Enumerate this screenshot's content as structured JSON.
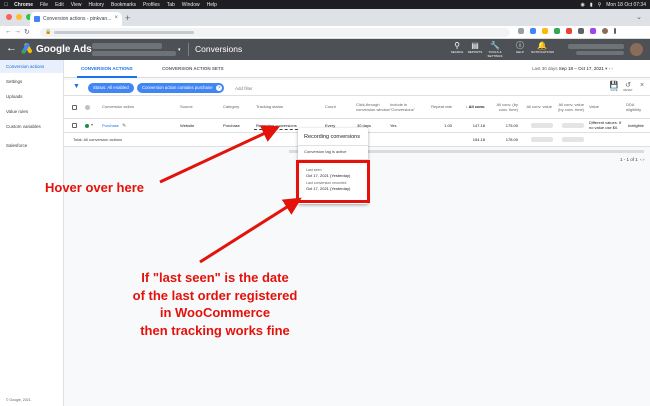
{
  "menubar": {
    "items": [
      "Chrome",
      "File",
      "Edit",
      "View",
      "History",
      "Bookmarks",
      "Profiles",
      "Tab",
      "Window",
      "Help"
    ],
    "clock": "Mon 18 Oct  07:34"
  },
  "browser": {
    "tab_title": "Conversion actions - pinkvan..."
  },
  "ads": {
    "brand": "Google Ads",
    "page_title": "Conversions",
    "header_icons": [
      "SEARCH",
      "REPORTS",
      "TOOLS & SETTINGS",
      "HELP",
      "NOTIFICATIONS"
    ]
  },
  "sidebar": {
    "items": [
      "Conversion actions",
      "Settings",
      "Uploads",
      "Value rules",
      "Custom variables",
      "Salesforce"
    ],
    "copyright": "© Google, 2021."
  },
  "subtabs": {
    "actions": "CONVERSION ACTIONS",
    "sets": "CONVERSION ACTION SETS",
    "range_label": "Last 30 days",
    "range_value": "Sep 18 – Oct 17, 2021"
  },
  "filters": {
    "chip1": "Status: All enabled",
    "chip2": "Conversion action contains purchase",
    "add_filter": "Add filter",
    "icon_labels": [
      "SAVE",
      "RESET"
    ]
  },
  "table": {
    "headers": {
      "action": "Conversion action",
      "source": "Source",
      "category": "Category",
      "tracking": "Tracking status",
      "count": "Count",
      "window": "Click-through conversion window",
      "include": "Include in \"Conversions\"",
      "repeat": "Repeat rate",
      "allconv": "All conv.",
      "byconvtime": "All conv. (by conv. time)",
      "value": "All conv. value",
      "valuebytime": "All conv. value (by conv. time)",
      "vbar": "Value",
      "dda": "DDA eligibility"
    },
    "row": {
      "action": "Purchase",
      "source": "Website",
      "category": "Purchase",
      "tracking": "Recording conversions",
      "count": "Every",
      "window": "30 days",
      "include": "Yes",
      "repeat": "1.00",
      "allconv": "147.18",
      "byconvtime": "175.00",
      "vbar": "Different values. If no value use $0.",
      "dda": "Ineligible"
    },
    "total": {
      "label": "Total: All conversion actions",
      "allconv": "154.18",
      "byconvtime": "178.00"
    },
    "pager": "1 - 1 of 1"
  },
  "tooltip": {
    "title": "Recording conversions",
    "status": "Conversion tag is active",
    "last_seen_label": "Last seen",
    "last_seen_value": "Oct 17, 2021 (Yesterday)",
    "last_recorded_label": "Last conversion recorded",
    "last_recorded_value": "Oct 17, 2021 (Yesterday)"
  },
  "annotations": {
    "hover": "Hover over here",
    "line1": "If \"last seen\" is the date",
    "line2": "of the last order registered",
    "line3": "in WooCommerce",
    "line4": "then tracking works fine",
    "color": "#e3120b"
  }
}
